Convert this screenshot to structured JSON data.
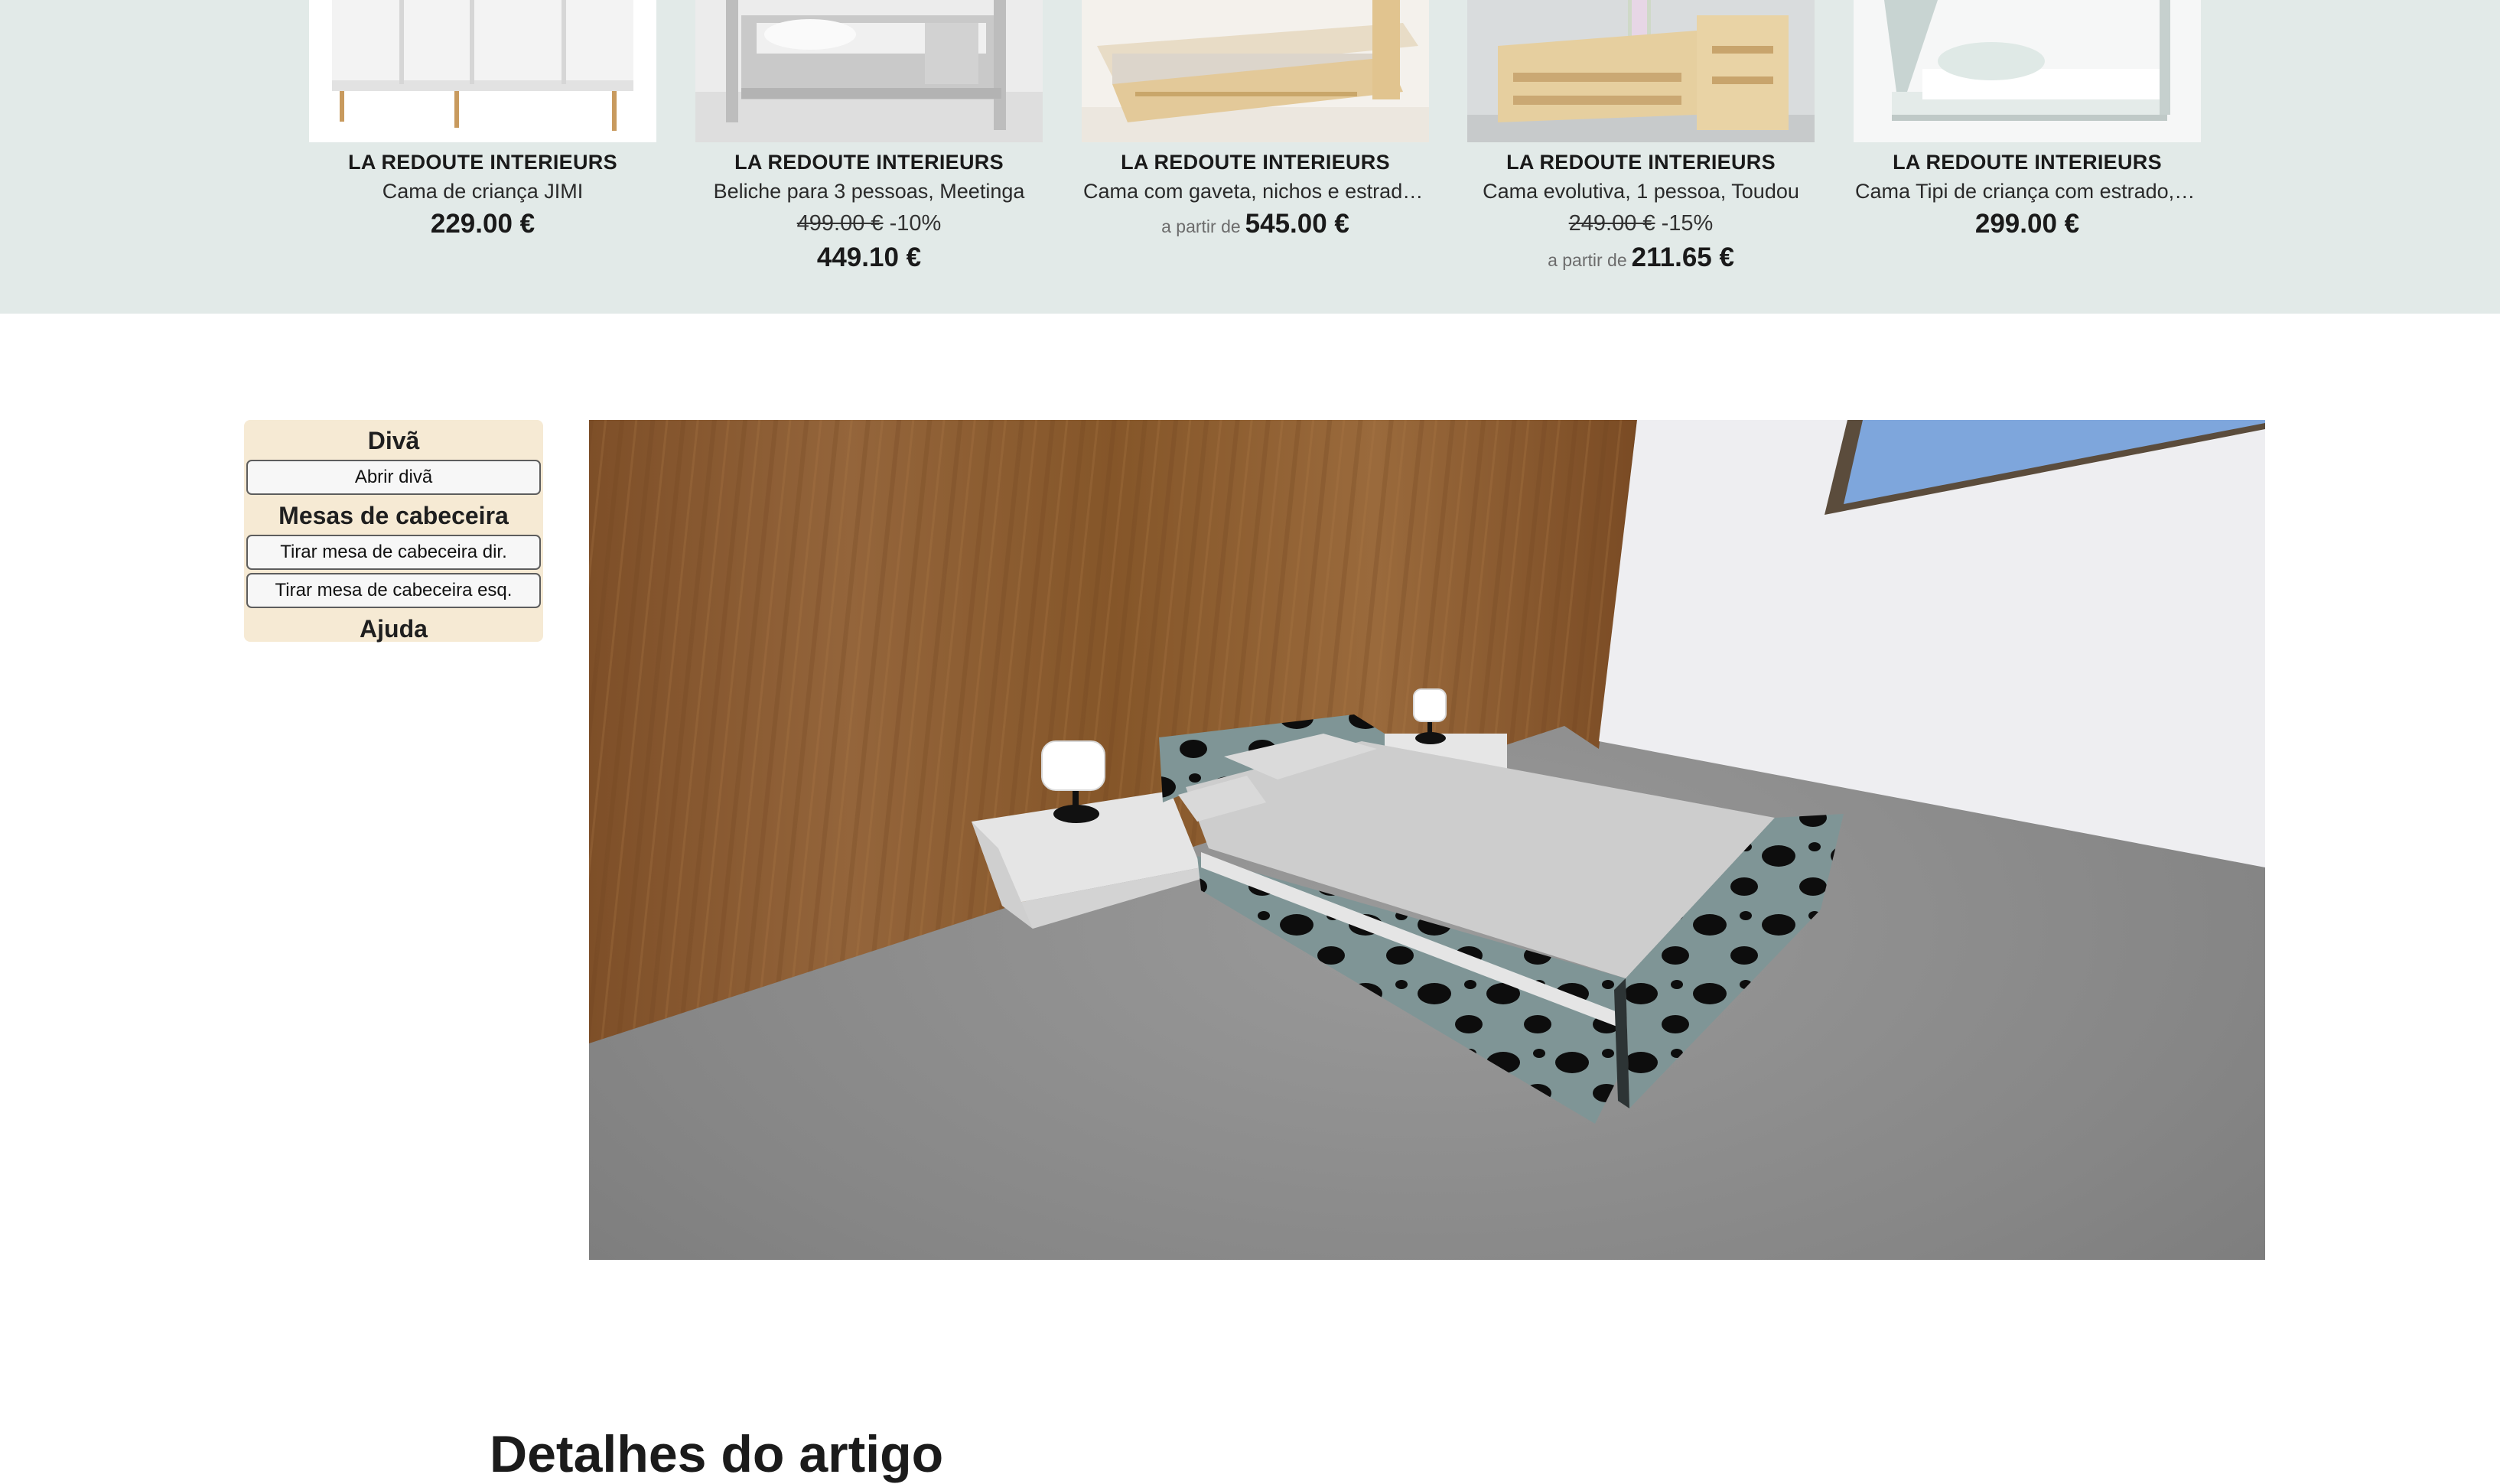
{
  "carousel": {
    "products": [
      {
        "brand": "LA REDOUTE INTERIEURS",
        "name": "Cama de criança JIMI",
        "old_price": "",
        "discount": "",
        "from_label": "",
        "price": "229.00 €",
        "image": "white-kids-bed-image"
      },
      {
        "brand": "LA REDOUTE INTERIEURS",
        "name": "Beliche para 3 pessoas, Meetinga",
        "old_price": "499.00 €",
        "discount": "-10%",
        "from_label": "",
        "price": "449.10 €",
        "image": "grey-bunk-bed-image"
      },
      {
        "brand": "LA REDOUTE INTERIEURS",
        "name": "Cama com gaveta, nichos e estrado ...",
        "old_price": "",
        "discount": "",
        "from_label": "a partir de",
        "price": "545.00 €",
        "image": "pine-drawer-bed-image"
      },
      {
        "brand": "LA REDOUTE INTERIEURS",
        "name": "Cama evolutiva, 1 pessoa, Toudou",
        "old_price": "249.00 €",
        "discount": "-15%",
        "from_label": "a partir de",
        "price": "211.65 €",
        "image": "pine-evolutive-bed-image"
      },
      {
        "brand": "LA REDOUTE INTERIEURS",
        "name": "Cama Tipi de criança com estrado, S...",
        "old_price": "",
        "discount": "",
        "from_label": "",
        "price": "299.00 €",
        "image": "tipi-bed-image"
      }
    ]
  },
  "panel": {
    "divan_title": "Divã",
    "open_divan": "Abrir divã",
    "nightstands_title": "Mesas de cabeceira",
    "remove_right": "Tirar mesa de cabeceira dir.",
    "remove_left": "Tirar mesa de cabeceira esq.",
    "help_title": "Ajuda"
  },
  "viewport": {
    "scene": "3d-bedroom-bed-preview",
    "colors": {
      "wood_wall": "#8b5a2f",
      "white_wall": "#f0f0f2",
      "floor": "#8a8a8a",
      "window": "#7fa7dd",
      "mattress": "#cdcdcd",
      "frame_fabric": "#7f9596"
    }
  },
  "details": {
    "heading": "Detalhes do artigo"
  }
}
